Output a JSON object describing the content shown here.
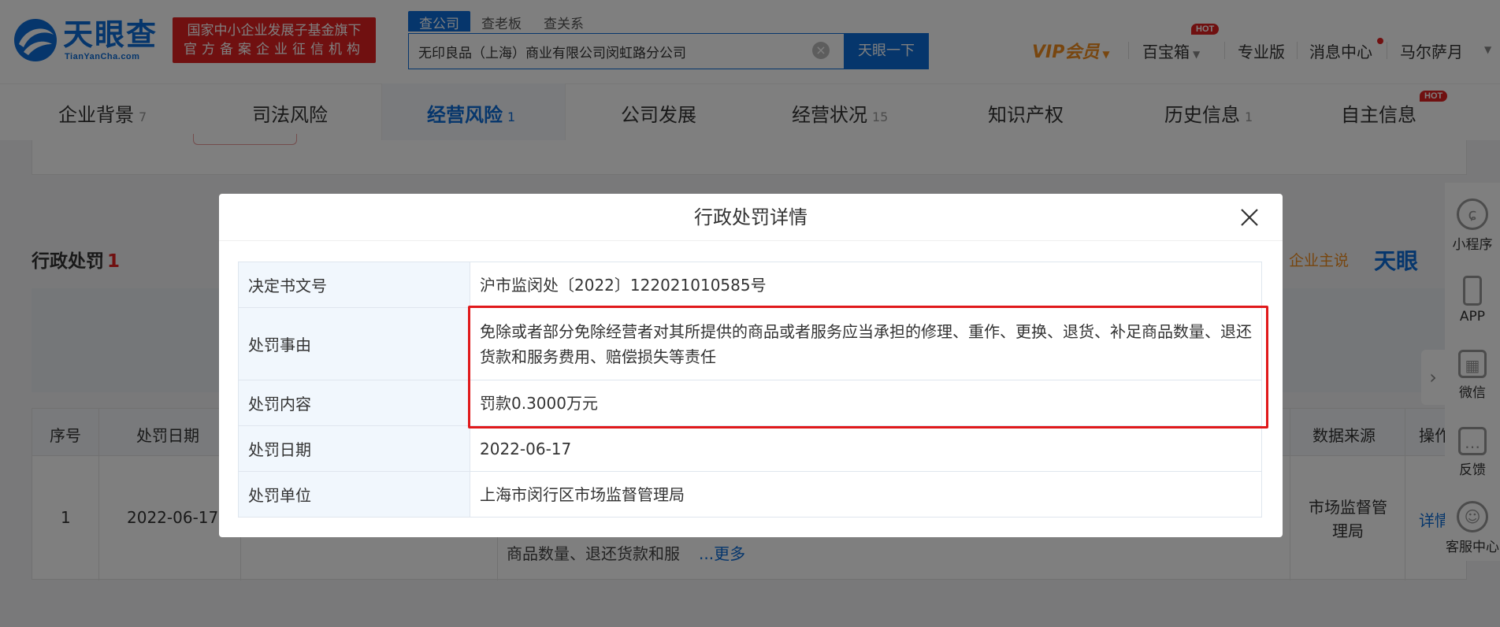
{
  "brand": {
    "logo_text": "天眼查",
    "logo_sub": "TianYanCha.com",
    "slogan_line1": "国家中小企业发展子基金旗下",
    "slogan_line2": "官方备案企业征信机构"
  },
  "search": {
    "tabs": [
      "查公司",
      "查老板",
      "查关系"
    ],
    "query": "无印良品（上海）商业有限公司闵虹路分公司",
    "button": "天眼一下"
  },
  "topnav": {
    "vip": "VIP会员",
    "treasure": "百宝箱",
    "pro": "专业版",
    "messages": "消息中心",
    "user": "马尔萨月",
    "hot": "HOT"
  },
  "tabs": [
    {
      "label": "企业背景",
      "count": "7"
    },
    {
      "label": "司法风险",
      "count": ""
    },
    {
      "label": "经营风险",
      "count": "1"
    },
    {
      "label": "公司发展",
      "count": ""
    },
    {
      "label": "经营状况",
      "count": "15"
    },
    {
      "label": "知识产权",
      "count": ""
    },
    {
      "label": "历史信息",
      "count": "1"
    },
    {
      "label": "自主信息",
      "count": ""
    }
  ],
  "background": {
    "section_title": "行政处罚",
    "section_count": "1",
    "right_text": "企业主说",
    "right_logo": "天眼",
    "table_headers": [
      "序号",
      "处罚日期",
      "数据来源",
      "操作"
    ],
    "row_index": "1",
    "row_date": "2022-06-17",
    "row_snippet": "商品数量、退还货款和服",
    "row_more": "...更多",
    "row_source": "市场监督管理局",
    "row_action": "详情"
  },
  "sidebar": [
    "小程序",
    "APP",
    "微信",
    "反馈",
    "客服中心"
  ],
  "modal": {
    "title": "行政处罚详情",
    "rows": [
      {
        "key": "决定书文号",
        "value": "沪市监闵处〔2022〕122021010585号"
      },
      {
        "key": "处罚事由",
        "value": "免除或者部分免除经营者对其所提供的商品或者服务应当承担的修理、重作、更换、退货、补足商品数量、退还货款和服务费用、赔偿损失等责任"
      },
      {
        "key": "处罚内容",
        "value": "罚款0.3000万元"
      },
      {
        "key": "处罚日期",
        "value": "2022-06-17"
      },
      {
        "key": "处罚单位",
        "value": "上海市闵行区市场监督管理局"
      }
    ]
  },
  "colors": {
    "brand_blue": "#0c6dd9",
    "alert_red": "#e0191b",
    "vip_orange": "#f08c1e"
  }
}
